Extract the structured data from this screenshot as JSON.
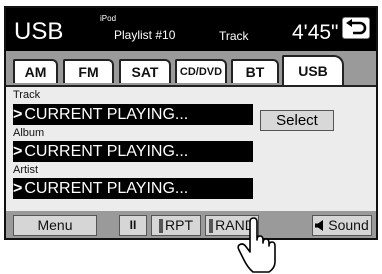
{
  "header": {
    "source": "USB",
    "device": "iPod",
    "playlist": "Playlist #10",
    "mode": "Track",
    "time": "4'45\""
  },
  "tabs": [
    {
      "label": "AM",
      "active": false
    },
    {
      "label": "FM",
      "active": false
    },
    {
      "label": "SAT",
      "active": false
    },
    {
      "label": "CD/DVD",
      "active": false
    },
    {
      "label": "BT",
      "active": false
    },
    {
      "label": "USB",
      "active": true
    }
  ],
  "fields": {
    "track": {
      "label": "Track",
      "value": "CURRENT PLAYING..."
    },
    "album": {
      "label": "Album",
      "value": "CURRENT PLAYING..."
    },
    "artist": {
      "label": "Artist",
      "value": "CURRENT PLAYING..."
    }
  },
  "buttons": {
    "select": "Select",
    "menu": "Menu",
    "pause": "II",
    "repeat": "RPT",
    "random": "RAND",
    "sound": "Sound"
  },
  "icons": {
    "back": "back-arrow-icon",
    "speaker": "speaker-icon",
    "cursor": "hand-pointer-icon"
  },
  "colors": {
    "header_bg": "#000000",
    "tab_strip": "#9a9a9a",
    "panel_bg": "#ececec"
  }
}
